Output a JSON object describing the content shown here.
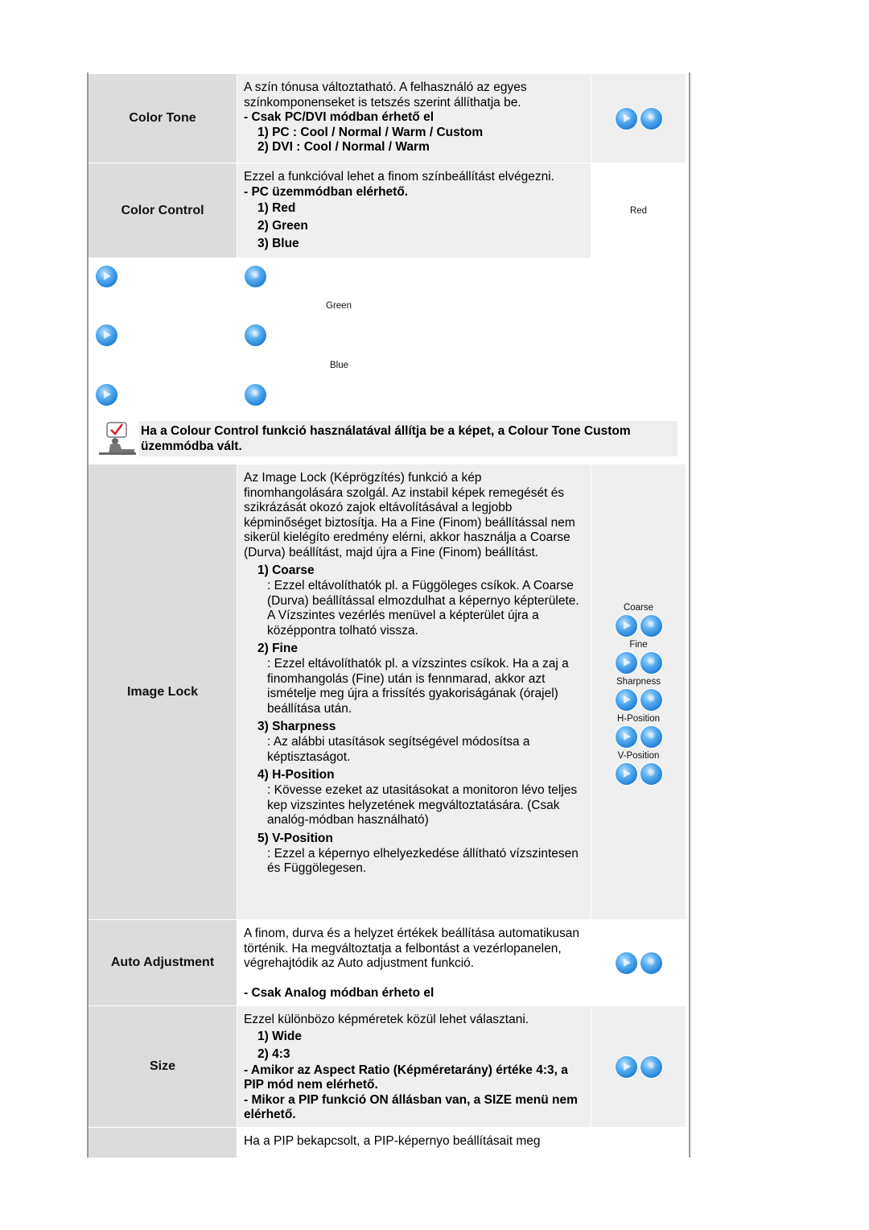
{
  "rows": {
    "color_tone": {
      "label": "Color Tone",
      "intro": "A szín tónusa változtatható. A felhasználó az egyes színkomponenseket is tetszés szerint állíthatja be.",
      "note": "- Csak PC/DVI módban érhető el",
      "items": [
        "1) PC : Cool / Normal / Warm / Custom",
        "2) DVI : Cool / Normal / Warm"
      ],
      "buttons": [
        "play-button",
        "enter-button"
      ]
    },
    "color_control": {
      "label": "Color Control",
      "intro": "Ezzel a funkcióval lehet a finom színbeállítást elvégezni.",
      "note": "- PC üzemmódban elérhető.",
      "items": [
        "1) Red",
        "2) Green",
        "3) Blue"
      ],
      "icon_label": "Red",
      "sub_labels": [
        "Green",
        "Blue"
      ]
    },
    "color_note": "Ha a Colour Control funkció használatával állítja be a képet, a Colour Tone Custom üzemmódba vált.",
    "image_lock": {
      "label": "Image Lock",
      "intro": "Az Image Lock (Képrögzítés) funkció a kép finomhangolására szolgál. Az instabil képek remegését és szikrázását okozó zajok eltávolításával a legjobb képminőséget biztosítja. Ha a Fine (Finom) beállítással nem sikerül kielégíto eredmény elérni, akkor használja a Coarse (Durva) beállítást, majd újra a Fine (Finom) beállítást.",
      "items": [
        {
          "title": "1) Coarse",
          "text": ": Ezzel eltávolíthatók pl. a Függöleges csíkok. A Coarse (Durva) beállítással elmozdulhat a képernyo képterülete. A Vízszintes vezérlés menüvel a képterület újra a középpontra tolható vissza."
        },
        {
          "title": "2) Fine",
          "text": ": Ezzel eltávolíthatók pl. a vízszintes csíkok. Ha a zaj a finomhangolás (Fine) után is fennmarad, akkor azt ismételje meg újra a frissítés gyakoriságának (órajel) beállítása után."
        },
        {
          "title": "3) Sharpness",
          "text": ": Az alábbi utasítások segítségével módosítsa a képtisztaságot."
        },
        {
          "title": "4) H-Position",
          "text": ": Kövesse ezeket az utasitásokat a monitoron lévo teljes kep vizszintes helyzetének megváltoztatására. (Csak analóg-módban használható)"
        },
        {
          "title": "5) V-Position",
          "text": ": Ezzel a képernyo elhelyezkedése állítható vízszintesen és Függölegesen."
        }
      ],
      "icon_labels": [
        "Coarse",
        "Fine",
        "Sharpness",
        "H-Position",
        "V-Position"
      ]
    },
    "auto_adjustment": {
      "label": "Auto Adjustment",
      "intro": "A finom, durva és a helyzet értékek beállítása automatikusan történik. Ha megváltoztatja a felbontást a vezérlopanelen, végrehajtódik az Auto adjustment funkció.",
      "note": "- Csak Analog módban érheto el"
    },
    "size": {
      "label": "Size",
      "intro": "Ezzel különbözo képméretek közül lehet választani.",
      "items": [
        "1) Wide",
        "2) 4:3"
      ],
      "notes": [
        "- Amikor az Aspect Ratio (Képméretarány) értéke 4:3, a PIP mód nem elérhető.",
        "- Mikor a PIP funkció ON állásban van, a SIZE menü nem elérhető."
      ]
    },
    "pip": {
      "intro": "Ha a PIP bekapcsolt, a PIP-képernyo beállításait meg"
    }
  },
  "colors": {
    "label_bg": "#dcdcdc",
    "desc_bg": "#efefef",
    "border": "#9a9a9a",
    "button_blue": "#1f7fd4"
  }
}
